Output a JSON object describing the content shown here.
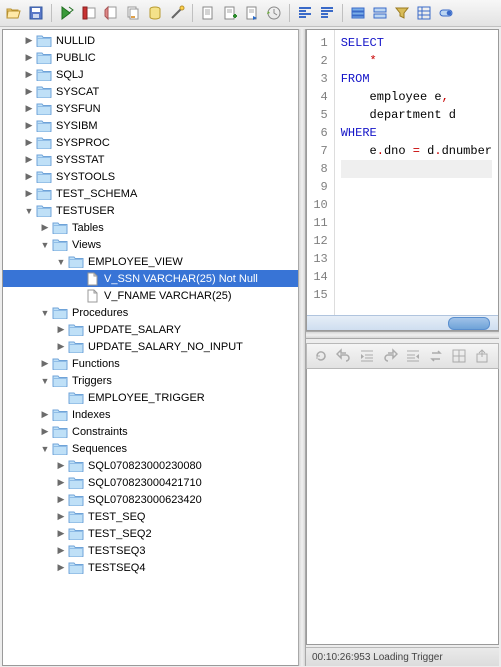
{
  "toolbar": {
    "icons": [
      "folder-open-icon",
      "save-icon",
      "sep",
      "run-sql-icon",
      "stop-sql-icon",
      "clear-icon",
      "copy-icon",
      "cylinder-icon",
      "wand-icon",
      "sep",
      "doc-icon",
      "doc-plus-icon",
      "doc-arrow-icon",
      "history-icon",
      "sep",
      "align-left-icon",
      "align-top-icon",
      "sep",
      "rows-icon",
      "rows2-icon",
      "filter-icon",
      "rows3-icon",
      "toggle-icon"
    ]
  },
  "tree": {
    "roots": [
      {
        "label": "NULLID",
        "level": 1,
        "type": "folder",
        "collapsed": true
      },
      {
        "label": "PUBLIC",
        "level": 1,
        "type": "folder",
        "collapsed": true
      },
      {
        "label": "SQLJ",
        "level": 1,
        "type": "folder",
        "collapsed": true
      },
      {
        "label": "SYSCAT",
        "level": 1,
        "type": "folder",
        "collapsed": true
      },
      {
        "label": "SYSFUN",
        "level": 1,
        "type": "folder",
        "collapsed": true
      },
      {
        "label": "SYSIBM",
        "level": 1,
        "type": "folder",
        "collapsed": true
      },
      {
        "label": "SYSPROC",
        "level": 1,
        "type": "folder",
        "collapsed": true
      },
      {
        "label": "SYSSTAT",
        "level": 1,
        "type": "folder",
        "collapsed": true
      },
      {
        "label": "SYSTOOLS",
        "level": 1,
        "type": "folder",
        "collapsed": true
      },
      {
        "label": "TEST_SCHEMA",
        "level": 1,
        "type": "folder",
        "collapsed": true
      },
      {
        "label": "TESTUSER",
        "level": 1,
        "type": "folder",
        "expanded": true
      },
      {
        "label": "Tables",
        "level": 2,
        "type": "folder",
        "collapsed": true
      },
      {
        "label": "Views",
        "level": 2,
        "type": "folder",
        "expanded": true
      },
      {
        "label": "EMPLOYEE_VIEW",
        "level": 3,
        "type": "folder",
        "expanded": true
      },
      {
        "label": "V_SSN VARCHAR(25) Not Null",
        "level": 4,
        "type": "file",
        "selected": true
      },
      {
        "label": "V_FNAME VARCHAR(25)",
        "level": 4,
        "type": "file"
      },
      {
        "label": "Procedures",
        "level": 2,
        "type": "folder",
        "expanded": true
      },
      {
        "label": "UPDATE_SALARY",
        "level": 3,
        "type": "folder",
        "collapsed": true
      },
      {
        "label": "UPDATE_SALARY_NO_INPUT",
        "level": 3,
        "type": "folder",
        "collapsed": true
      },
      {
        "label": "Functions",
        "level": 2,
        "type": "folder",
        "collapsed": true
      },
      {
        "label": "Triggers",
        "level": 2,
        "type": "folder",
        "expanded": true
      },
      {
        "label": "EMPLOYEE_TRIGGER",
        "level": 3,
        "type": "folder",
        "leaf": true
      },
      {
        "label": "Indexes",
        "level": 2,
        "type": "folder",
        "collapsed": true
      },
      {
        "label": "Constraints",
        "level": 2,
        "type": "folder",
        "collapsed": true
      },
      {
        "label": "Sequences",
        "level": 2,
        "type": "folder",
        "expanded": true
      },
      {
        "label": "SQL070823000230080",
        "level": 3,
        "type": "folder",
        "collapsed": true
      },
      {
        "label": "SQL070823000421710",
        "level": 3,
        "type": "folder",
        "collapsed": true
      },
      {
        "label": "SQL070823000623420",
        "level": 3,
        "type": "folder",
        "collapsed": true
      },
      {
        "label": "TEST_SEQ",
        "level": 3,
        "type": "folder",
        "collapsed": true
      },
      {
        "label": "TEST_SEQ2",
        "level": 3,
        "type": "folder",
        "collapsed": true
      },
      {
        "label": "TESTSEQ3",
        "level": 3,
        "type": "folder",
        "collapsed": true
      },
      {
        "label": "TESTSEQ4",
        "level": 3,
        "type": "folder",
        "collapsed": true
      }
    ]
  },
  "editor": {
    "line_count": 15,
    "tokens": [
      [
        {
          "t": "SELECT",
          "c": "kw"
        }
      ],
      [
        {
          "t": "    ",
          "c": ""
        },
        {
          "t": "*",
          "c": "str"
        }
      ],
      [
        {
          "t": "FROM",
          "c": "kw"
        }
      ],
      [
        {
          "t": "    employee e",
          "c": ""
        },
        {
          "t": ",",
          "c": "str"
        }
      ],
      [
        {
          "t": "    department d",
          "c": ""
        }
      ],
      [
        {
          "t": "WHERE",
          "c": "kw"
        }
      ],
      [
        {
          "t": "    e",
          "c": ""
        },
        {
          "t": ".",
          "c": "str"
        },
        {
          "t": "dno ",
          "c": ""
        },
        {
          "t": "=",
          "c": "str"
        },
        {
          "t": " d",
          "c": ""
        },
        {
          "t": ".",
          "c": "str"
        },
        {
          "t": "dnumber",
          "c": ""
        }
      ],
      [],
      [],
      [],
      [],
      [],
      [],
      [],
      []
    ],
    "cursor_line": 8
  },
  "bottom_toolbar": {
    "icons": [
      "refresh-icon",
      "undo-icon",
      "indent-icon",
      "redo-plus-icon",
      "outdent-icon",
      "swap-icon",
      "grid-icon",
      "export-icon"
    ]
  },
  "status": {
    "text": "00:10:26:953 Loading Trigger"
  }
}
